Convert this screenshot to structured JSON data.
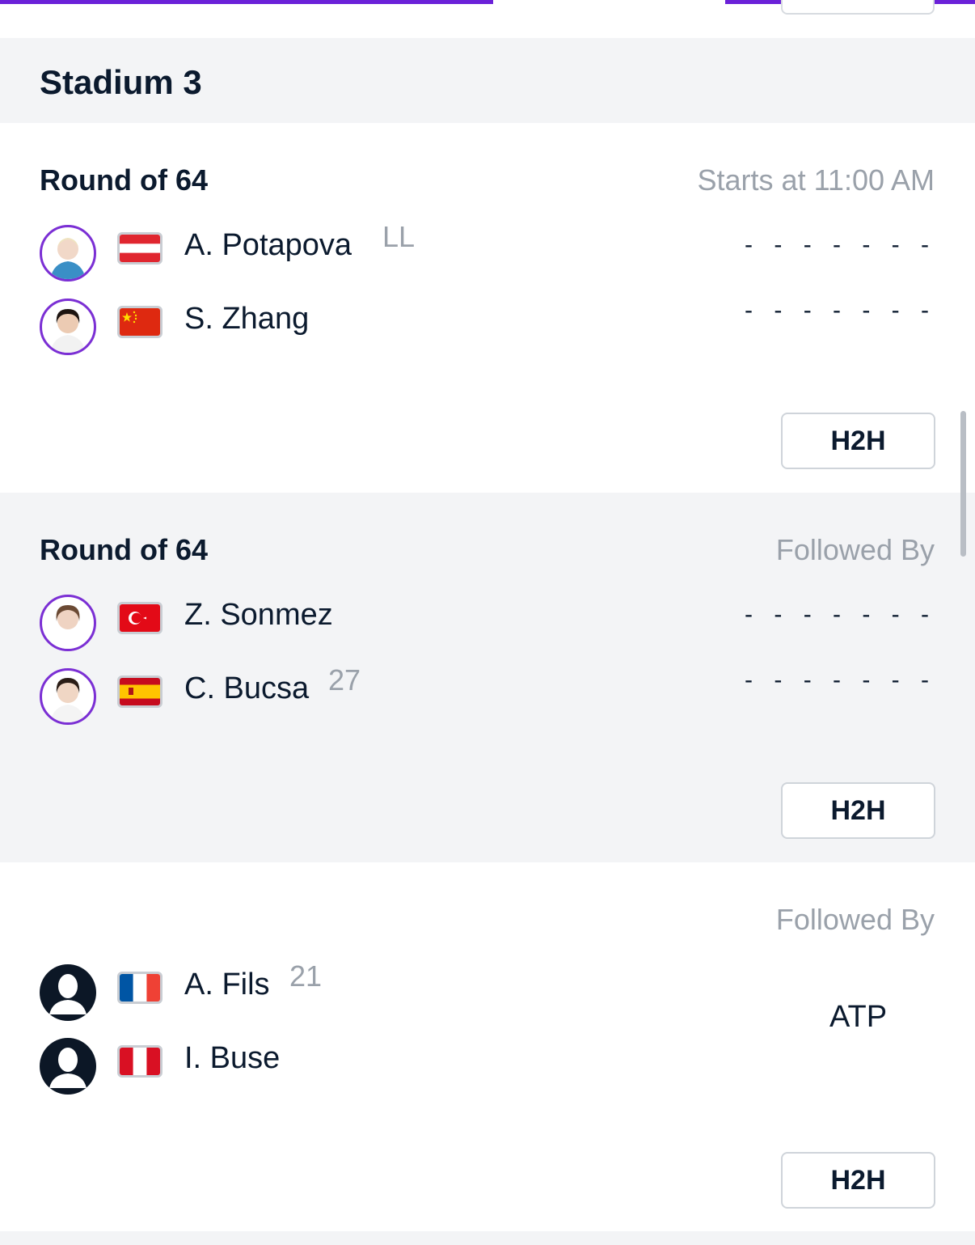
{
  "stadium": {
    "title": "Stadium 3"
  },
  "matches": [
    {
      "round": "Round of 64",
      "status": "Starts at 11:00 AM",
      "players": [
        {
          "name": "A. Potapova",
          "seed": "LL",
          "flag": "austria-flag",
          "score": "- - - - - - -"
        },
        {
          "name": "S. Zhang",
          "seed": "",
          "flag": "china-flag",
          "score": "- - - - - - -"
        }
      ],
      "h2h": "H2H"
    },
    {
      "round": "Round of 64",
      "status": "Followed By",
      "players": [
        {
          "name": "Z. Sonmez",
          "seed": "",
          "flag": "turkey-flag",
          "score": "- - - - - - -"
        },
        {
          "name": "C. Bucsa",
          "seed": "27",
          "flag": "spain-flag",
          "score": "- - - - - - -"
        }
      ],
      "h2h": "H2H"
    },
    {
      "round": "",
      "status": "Followed By",
      "tour": "ATP",
      "players": [
        {
          "name": "A. Fils",
          "seed": "21",
          "flag": "france-flag"
        },
        {
          "name": "I. Buse",
          "seed": "",
          "flag": "peru-flag"
        }
      ],
      "h2h": "H2H"
    }
  ],
  "colors": {
    "accent": "#6b21d8",
    "avatar_ring": "#7b2fd4",
    "muted": "#9aa1aa",
    "text": "#0b1a2e",
    "panel_gray": "#f3f4f6"
  }
}
